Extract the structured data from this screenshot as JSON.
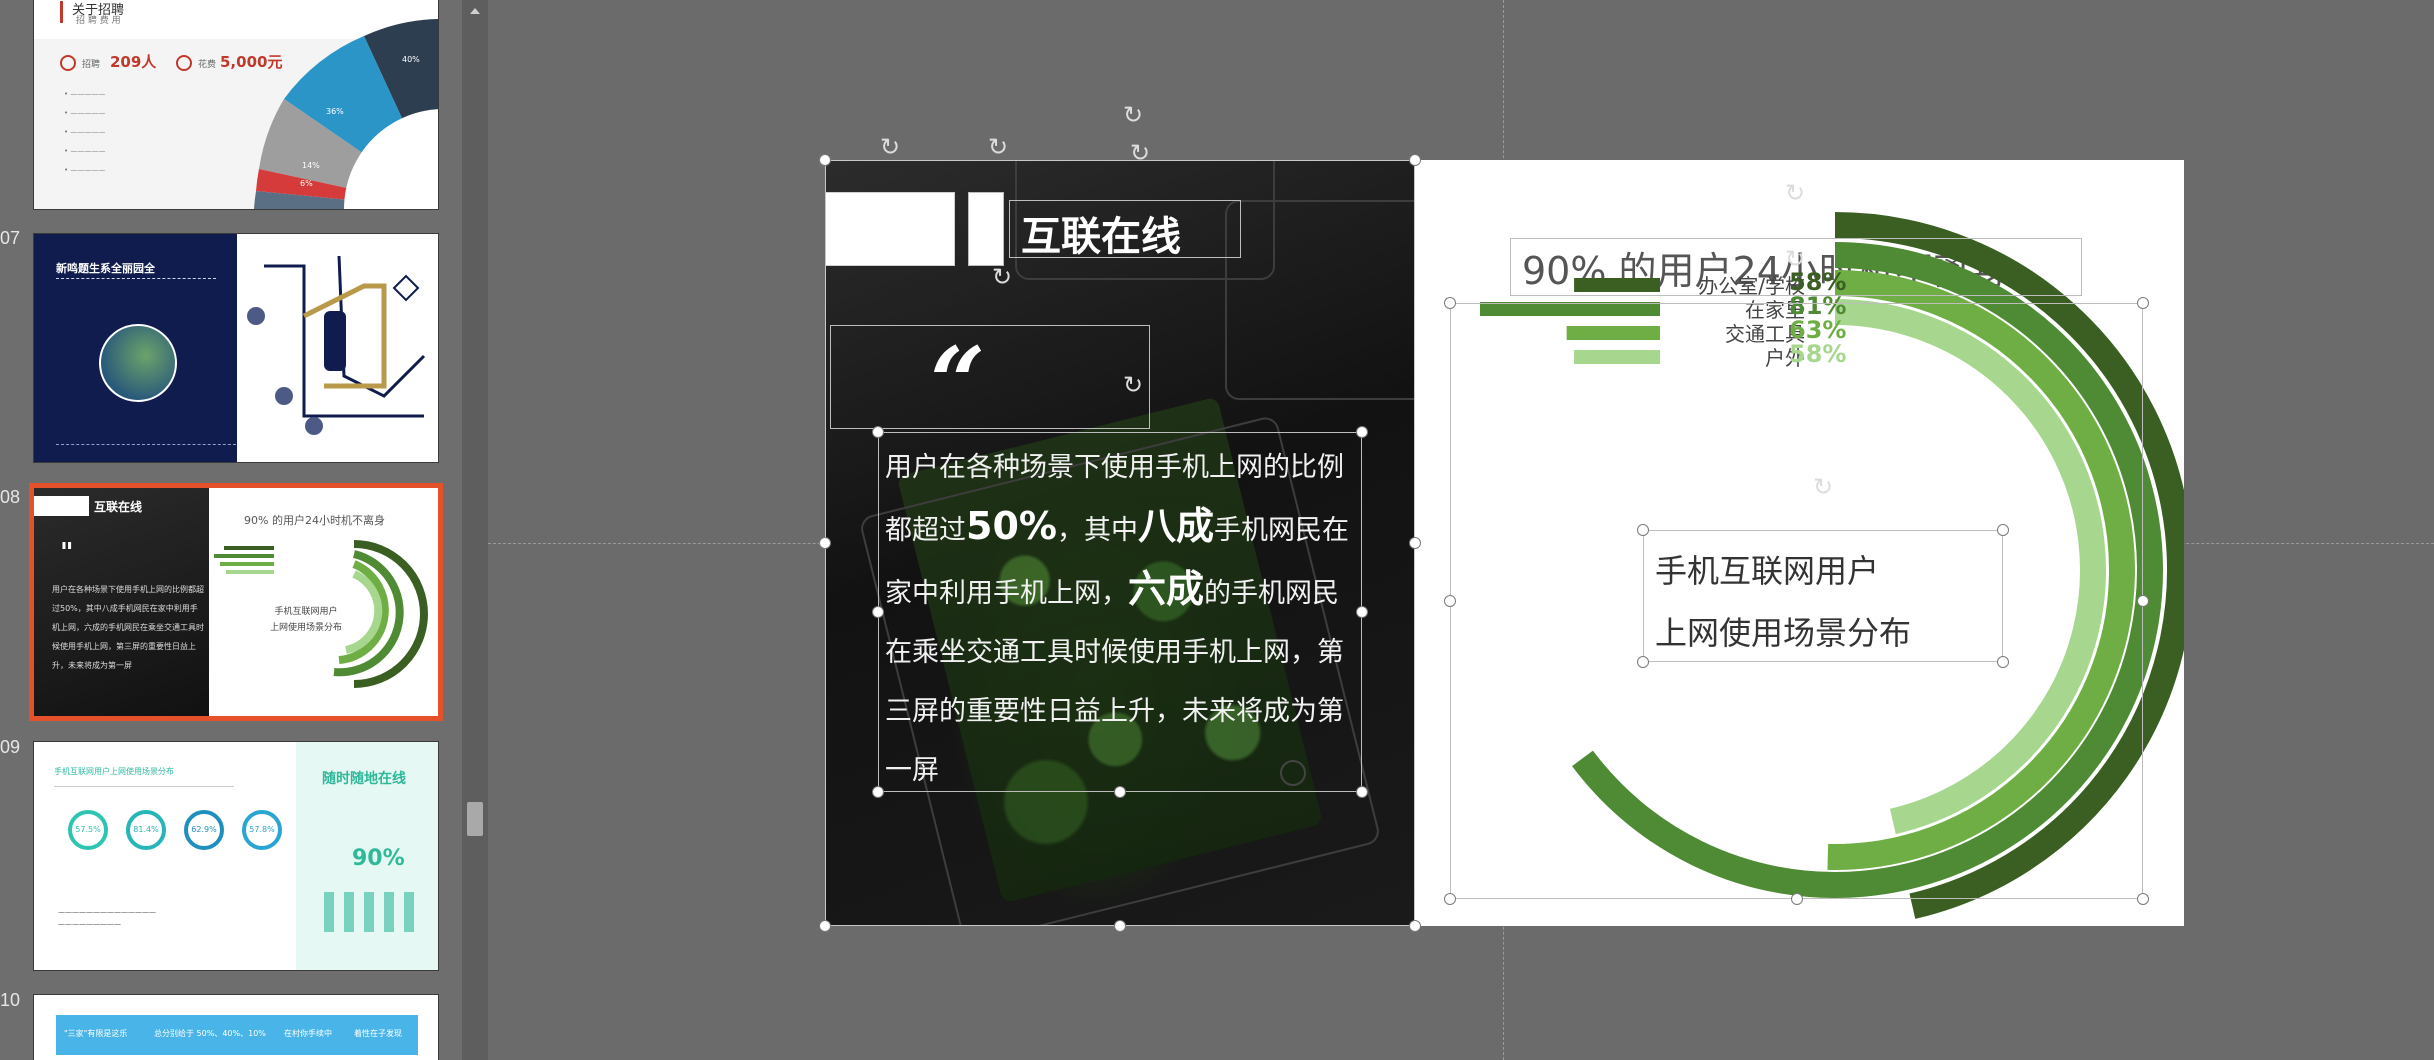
{
  "colors": {
    "accent_dark": "#3b5e22",
    "accent_mid": "#4f8a34",
    "accent_light": "#6fae45",
    "accent_pale": "#a7d78e",
    "selection": "#e5512b"
  },
  "thumbnails": [
    {
      "number": "",
      "title": "关于招聘",
      "subtitle": "招 聘 费 用",
      "stat1": "209人",
      "stat2": "5,000元",
      "stat1_label": "招聘",
      "stat2_label": "花费",
      "pct_a": "40%",
      "pct_b": "36%",
      "pct_c": "14%",
      "pct_d": "6%"
    },
    {
      "number": "07",
      "title": "新鸣题生系全丽园全"
    },
    {
      "number": "08",
      "title": "互联在线",
      "chart_title": "90% 的用户24小时机不离身",
      "label": "手机互联网用户\n上网使用场景分布"
    },
    {
      "number": "09",
      "title": "随时随地在线",
      "subtitle": "手机互联网用户上网使用场景分布",
      "values": [
        "57.5%",
        "81.4%",
        "62.9%",
        "57.8%"
      ],
      "names": [
        "办公室/学校",
        "在家里",
        "交通工具",
        "户外"
      ],
      "big": "90%"
    },
    {
      "number": "10",
      "cells": [
        "\"三家\"有限是这乐",
        "总分别给于 50%、40%、10%",
        "在村你手续中",
        "着性在子发现"
      ]
    }
  ],
  "slide": {
    "title": "互联在线",
    "quote": "“",
    "body_parts": [
      {
        "t": "用户在各种场景下使用手机上网的比例都超过",
        "b": false
      },
      {
        "t": "50%",
        "b": true
      },
      {
        "t": "，其中",
        "b": false
      },
      {
        "t": "八成",
        "b": true
      },
      {
        "t": "手机网民在家中利用手机上网，",
        "b": false
      },
      {
        "t": "六成",
        "b": true
      },
      {
        "t": "的手机网民在乘坐交通工具时候使用手机上网，第三屏的重要性日益上升，未来将成为第一屏",
        "b": false
      }
    ],
    "chart_title": "90% 的用户24小时机不离身",
    "center_label_1": "手机互联网用户",
    "center_label_2": "上网使用场景分布"
  },
  "chart_data": {
    "type": "bar",
    "categories": [
      "办公室/学校",
      "在家里",
      "交通工具",
      "户外"
    ],
    "values": [
      58,
      81,
      63,
      58
    ],
    "value_labels": [
      "58%",
      "81%",
      "63%",
      "58%"
    ],
    "series_colors": [
      "#3b5e22",
      "#4f8a34",
      "#6fae45",
      "#a7d78e"
    ],
    "ylim": [
      0,
      100
    ]
  }
}
